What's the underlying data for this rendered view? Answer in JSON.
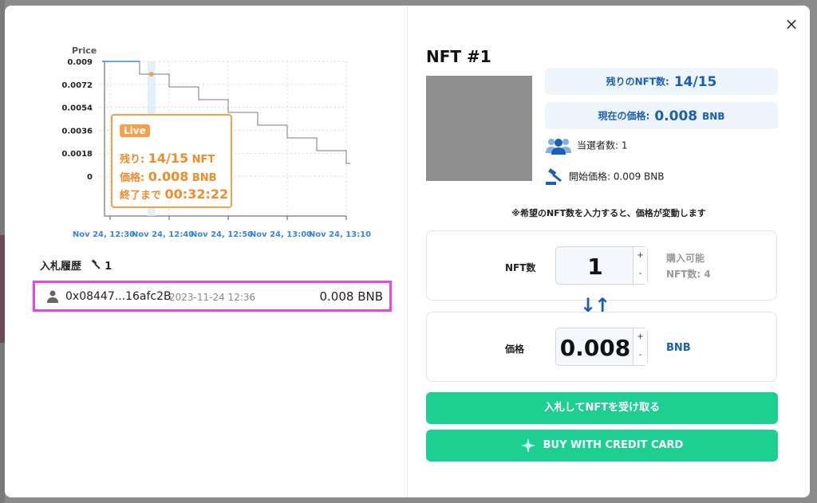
{
  "colors": {
    "accent_green": "#1ecf92",
    "accent_blue": "#1a5fb4",
    "live_orange": "#f08c2a",
    "highlight_magenta": "#ec43e8"
  },
  "modal": {
    "close_label": "×"
  },
  "chart_data": {
    "type": "line",
    "title": "",
    "ylabel": "Price",
    "xlabel": "",
    "y_ticks": [
      "0.009",
      "0.0072",
      "0.0054",
      "0.0036",
      "0.0018",
      "0"
    ],
    "x_ticks": [
      "Nov 24, 12:30",
      "Nov 24, 12:40",
      "Nov 24, 12:50",
      "Nov 24, 13:00",
      "Nov 24, 13:10"
    ],
    "ylim": [
      0,
      0.009
    ],
    "series": [
      {
        "x": [
          "12:30",
          "12:35",
          "12:40",
          "12:45",
          "12:50",
          "12:55",
          "13:00",
          "13:05",
          "13:10"
        ],
        "values": [
          0.009,
          0.008,
          0.007,
          0.006,
          0.005,
          0.004,
          0.003,
          0.002,
          0.001
        ]
      }
    ],
    "highlight_point": {
      "x": "12:37",
      "value": 0.008
    },
    "grid": true
  },
  "live": {
    "badge": "Live",
    "remain_label": "残り: ",
    "remain_value": "14/15",
    "remain_unit": " NFT",
    "price_label": "価格: ",
    "price_value": "0.008",
    "price_unit": " BNB",
    "end_label": "終了まで ",
    "end_value": "00:32:22"
  },
  "bid_history": {
    "title": "入札履歴",
    "count": "1",
    "rows": [
      {
        "address": "0x08447...16afc2B",
        "time": "2023-11-24 12:36",
        "amount": "0.008 BNB"
      }
    ]
  },
  "nft": {
    "title": "NFT #1",
    "remaining_label": "残りのNFT数:",
    "remaining_value": "14/15",
    "price_label": "現在の価格:",
    "price_value": "0.008",
    "price_unit": "BNB",
    "winners": "当選者数: 1",
    "start_price": "開始価格: 0.009 BNB"
  },
  "calc": {
    "hint": "※希望のNFT数を入力すると、価格が変動します",
    "nft_label": "NFT数",
    "nft_value": "1",
    "available_line1": "購入可能",
    "available_line2": "NFT数: 4",
    "price_label": "価格",
    "price_value": "0.008",
    "price_unit": "BNB",
    "plus": "+",
    "minus": "-",
    "swap": "↓↑"
  },
  "buttons": {
    "bid": "入札してNFTを受け取る",
    "credit": "BUY WITH CREDIT CARD"
  }
}
